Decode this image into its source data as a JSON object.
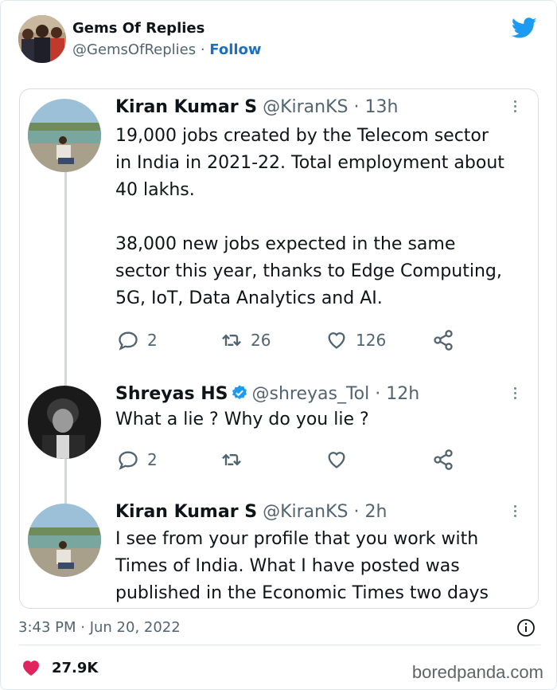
{
  "header": {
    "name": "Gems Of Replies",
    "handle": "@GemsOfReplies",
    "separator": " · ",
    "follow_label": "Follow"
  },
  "tweets": [
    {
      "name": "Kiran Kumar S",
      "handle": "@KiranKS",
      "time": "13h",
      "lines": [
        "19,000 jobs created by the Telecom sector",
        "in India in 2021-22. Total employment about",
        "40 lakhs.",
        "",
        "38,000 new jobs expected in the same",
        "sector this year, thanks to Edge Computing,",
        "5G, IoT, Data Analytics and AI."
      ],
      "replies": "2",
      "retweets": "26",
      "likes": "126"
    },
    {
      "name": "Shreyas HS",
      "handle": "@shreyas_Tol",
      "time": "12h",
      "verified": true,
      "lines": [
        "What a lie ? Why do you lie ?"
      ],
      "replies": "2",
      "retweets": "",
      "likes": ""
    },
    {
      "name": "Kiran Kumar S",
      "handle": "@KiranKS",
      "time": "2h",
      "lines": [
        "I see from your profile that you work with",
        "Times of India. What I have posted was",
        "published in the Economic Times two days"
      ]
    }
  ],
  "footer": {
    "timestamp": "3:43 PM · Jun 20, 2022",
    "like_count": "27.9K",
    "watermark": "boredpanda.com"
  },
  "colors": {
    "twitter_blue": "#1d9bf0",
    "follow_blue": "#1d6fc2",
    "heart_pink": "#e0245e",
    "verified_blue": "#1d9bf0"
  }
}
